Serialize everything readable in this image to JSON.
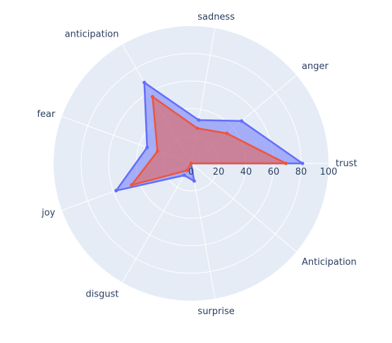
{
  "chart_data": {
    "type": "radar",
    "categories": [
      "trust",
      "anger",
      "sadness",
      "anticipation",
      "fear",
      "joy",
      "disgust",
      "surprise",
      "Anticipation"
    ],
    "radial_ticks": [
      0,
      20,
      40,
      60,
      80,
      100
    ],
    "rlim": [
      0,
      100
    ],
    "grid": true,
    "series": [
      {
        "values": [
          81,
          48,
          32,
          68,
          34,
          58,
          10,
          13,
          0
        ],
        "line_color": "#636efa",
        "fill_color": "#636efa"
      },
      {
        "values": [
          69,
          34,
          26,
          56,
          26,
          46,
          6,
          0,
          0
        ],
        "line_color": "#ef553b",
        "fill_color": "#ef553b"
      }
    ],
    "colors": {
      "polar_background": "#e5ecf6",
      "grid": "#ffffff",
      "text": "#2a3f5f"
    }
  }
}
